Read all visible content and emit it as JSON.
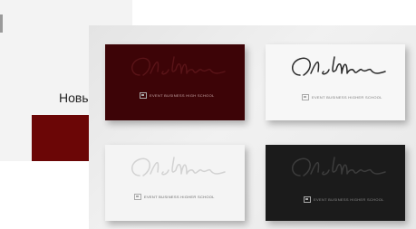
{
  "background_panel": {
    "label": "Новы",
    "swatch_color": "#6b0606"
  },
  "cards": [
    {
      "position": "top-left",
      "bg": "#3d0407",
      "ink": "#5a1418",
      "tagline_color": "#c9a9a9",
      "tagline": "EVENT BUSINESS HIGH SCHOOL",
      "signature": "Olia Martin"
    },
    {
      "position": "top-right",
      "bg": "#f7f7f7",
      "ink": "#2a2a2a",
      "tagline_color": "#777777",
      "tagline": "EVENT BUSINESS HIGHER SCHOOL",
      "signature": "Olia Martin"
    },
    {
      "position": "bottom-left",
      "bg": "#f4f4f4",
      "ink": "#d2d2d2",
      "tagline_color": "#666666",
      "tagline": "EVENT BUSINESS HIGHER SCHOOL",
      "signature": "Olia Martin"
    },
    {
      "position": "bottom-right",
      "bg": "#1b1b1b",
      "ink": "#3c3c3c",
      "tagline_color": "#8a8a8a",
      "tagline": "EVENT BUSINESS HIGHER SCHOOL",
      "signature": "Olia Martin"
    }
  ]
}
